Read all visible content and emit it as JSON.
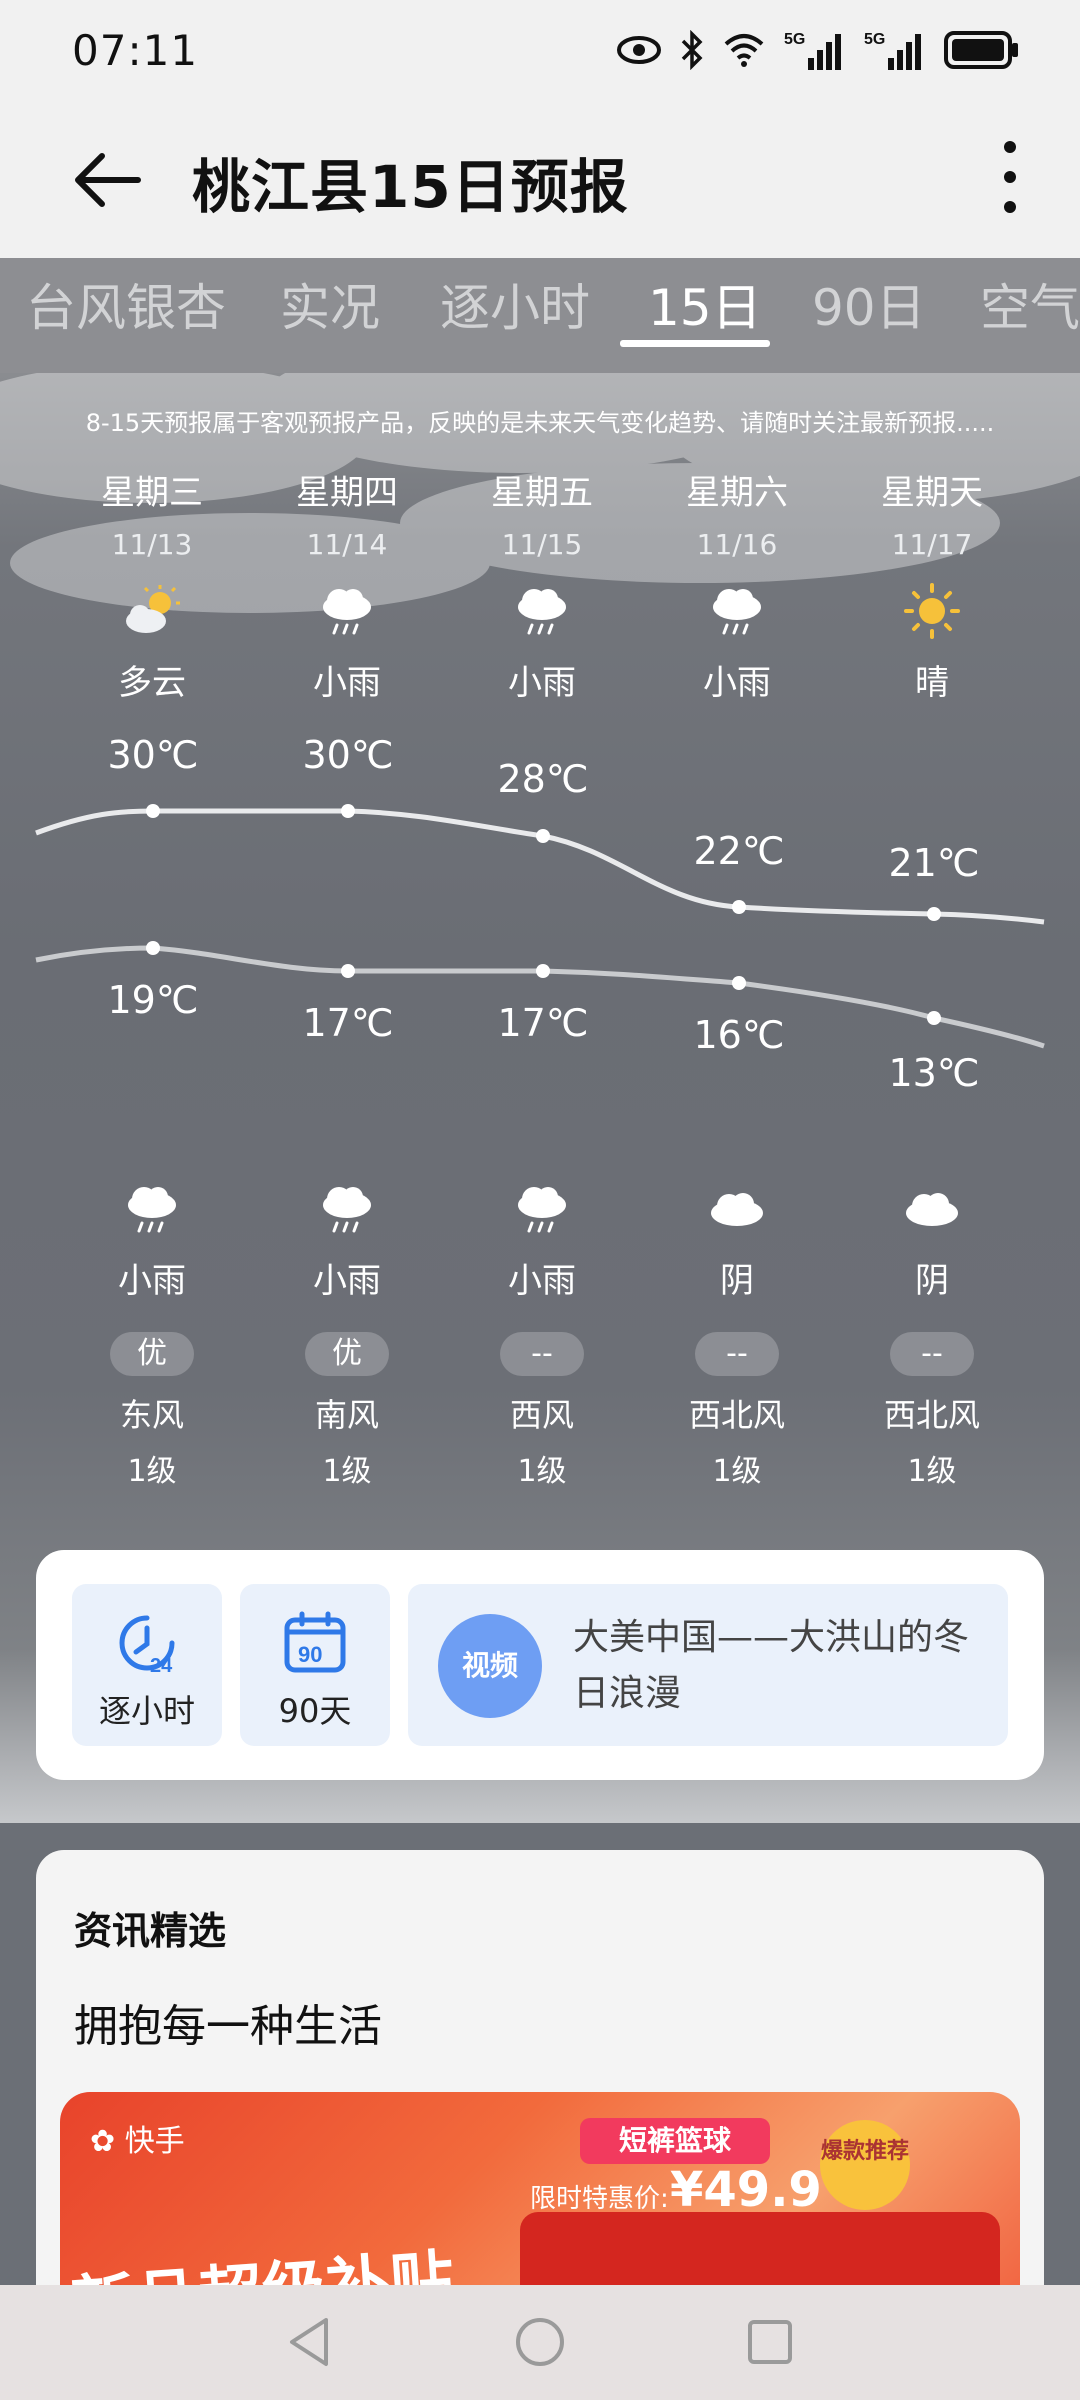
{
  "status_bar": {
    "time": "07:11",
    "net1": "5G",
    "net2": "5G"
  },
  "header": {
    "title": "桃江县15日预报"
  },
  "tabs": [
    {
      "label": "台风银杏",
      "active": false
    },
    {
      "label": "实况",
      "active": false
    },
    {
      "label": "逐小时",
      "active": false
    },
    {
      "label": "15日",
      "active": true
    },
    {
      "label": "90日",
      "active": false
    },
    {
      "label": "空气",
      "active": false
    }
  ],
  "notice": "8-15天预报属于客观预报产品，反映的是未来天气变化趋势、请随时关注最新预报.....",
  "days": [
    {
      "dow": "星期三",
      "date": "11/13",
      "day_icon": "partly-cloudy-icon",
      "day_cond": "多云",
      "high": "30℃",
      "low": "19℃",
      "night_icon": "rain-icon",
      "night_cond": "小雨",
      "aqi": "优",
      "wind_dir": "东风",
      "wind_lvl": "1级"
    },
    {
      "dow": "星期四",
      "date": "11/14",
      "day_icon": "rain-icon",
      "day_cond": "小雨",
      "high": "30℃",
      "low": "17℃",
      "night_icon": "rain-icon",
      "night_cond": "小雨",
      "aqi": "优",
      "wind_dir": "南风",
      "wind_lvl": "1级"
    },
    {
      "dow": "星期五",
      "date": "11/15",
      "day_icon": "rain-icon",
      "day_cond": "小雨",
      "high": "28℃",
      "low": "17℃",
      "night_icon": "rain-icon",
      "night_cond": "小雨",
      "aqi": "--",
      "wind_dir": "西风",
      "wind_lvl": "1级"
    },
    {
      "dow": "星期六",
      "date": "11/16",
      "day_icon": "rain-icon",
      "day_cond": "小雨",
      "high": "22℃",
      "low": "16℃",
      "night_icon": "cloud-icon",
      "night_cond": "阴",
      "aqi": "--",
      "wind_dir": "西北风",
      "wind_lvl": "1级"
    },
    {
      "dow": "星期天",
      "date": "11/17",
      "day_icon": "sun-icon",
      "day_cond": "晴",
      "high": "21℃",
      "low": "13℃",
      "night_icon": "cloud-icon",
      "night_cond": "阴",
      "aqi": "--",
      "wind_dir": "西北风",
      "wind_lvl": "1级"
    }
  ],
  "quick": {
    "hourly_icon_text": "24",
    "hourly_label": "逐小时",
    "days90_icon_text": "90",
    "days90_label": "90天",
    "video_badge": "视频",
    "video_text": "大美中国——大洪山的冬日浪漫"
  },
  "news": {
    "section_title": "资讯精选",
    "subtitle": "拥抱每一种生活",
    "ad": {
      "brand": "快手",
      "headline": "新品超级补贴",
      "ribbon": "短裤篮球",
      "price_label": "限时特惠价:",
      "price": "¥49.9",
      "tag": "爆款推荐"
    }
  },
  "colors": {
    "accent_blue": "#2f79e8",
    "video_badge": "#6e9ef3",
    "ad_red": "#e8432b"
  }
}
